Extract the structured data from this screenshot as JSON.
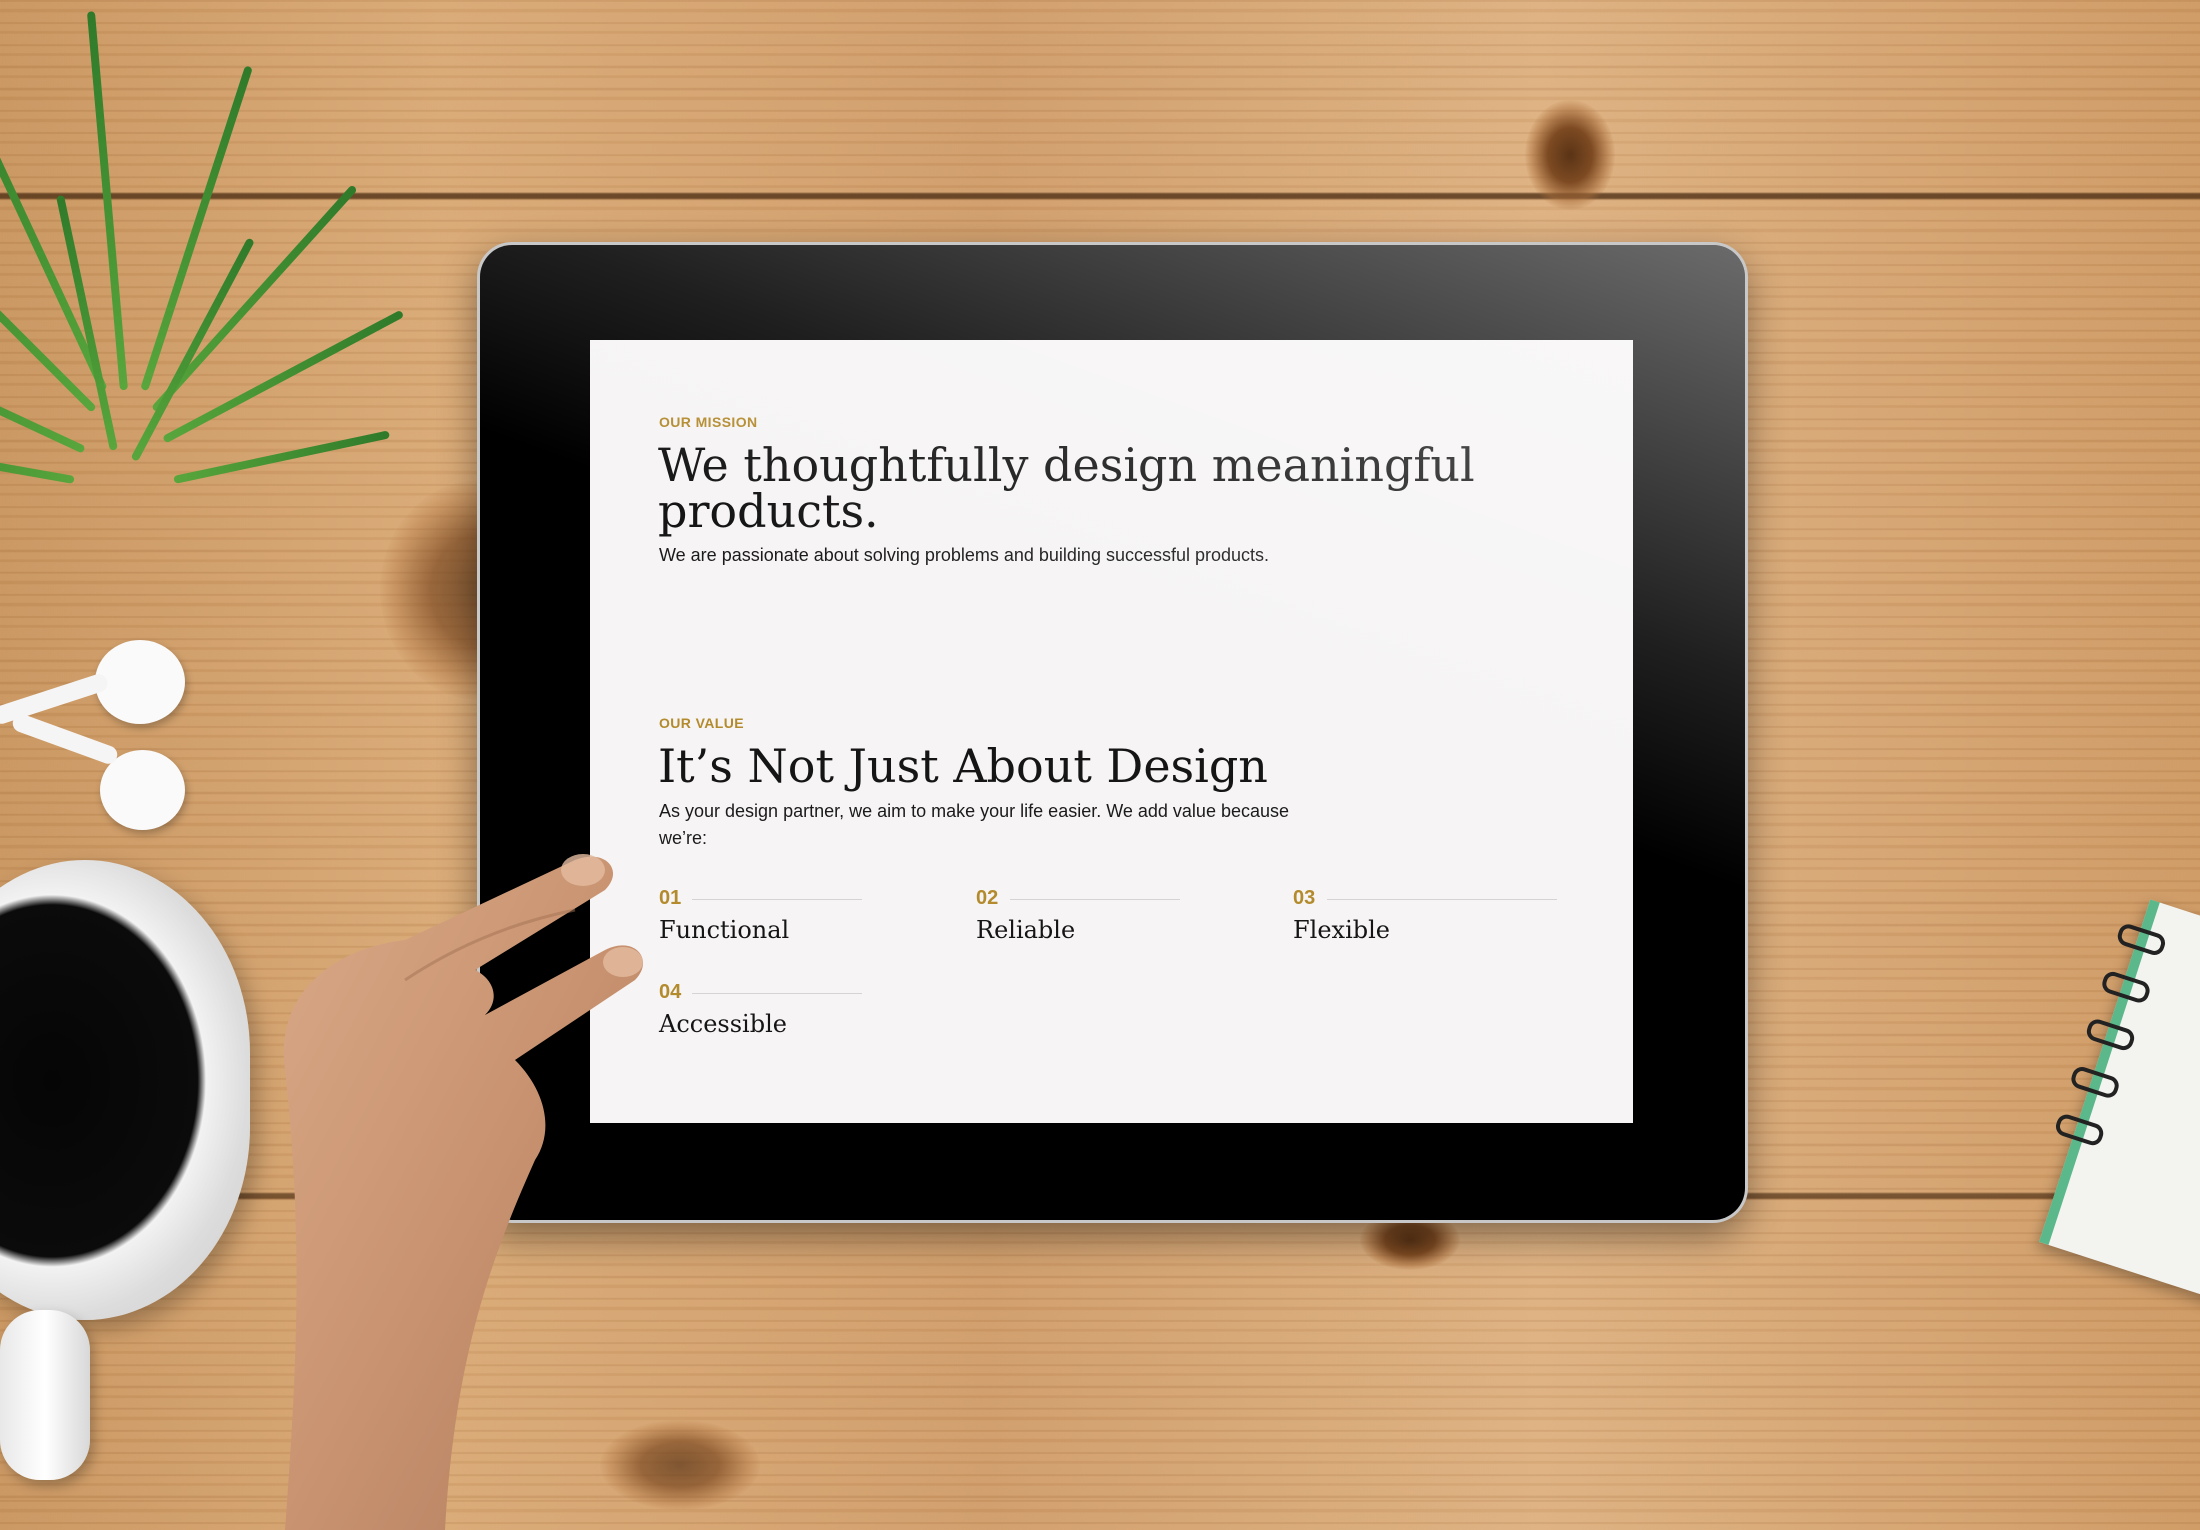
{
  "mission": {
    "eyebrow": "OUR MISSION",
    "headline_line1": "We thoughtfully design meaningful",
    "headline_line2": "products.",
    "subtitle": "We are passionate about solving problems and building successful products."
  },
  "value": {
    "eyebrow": "OUR VALUE",
    "headline": "It’s Not Just About Design",
    "body_line1": "As your design partner, we aim to make your life easier. We add value because",
    "body_line2": "we’re:"
  },
  "features": [
    {
      "number": "01",
      "name": "Functional"
    },
    {
      "number": "02",
      "name": "Reliable"
    },
    {
      "number": "03",
      "name": "Flexible"
    },
    {
      "number": "04",
      "name": "Accessible"
    }
  ],
  "colors": {
    "accent": "#b38b2d",
    "text": "#151515",
    "screen_bg": "#f6f4f4",
    "bezel": "#000000"
  }
}
